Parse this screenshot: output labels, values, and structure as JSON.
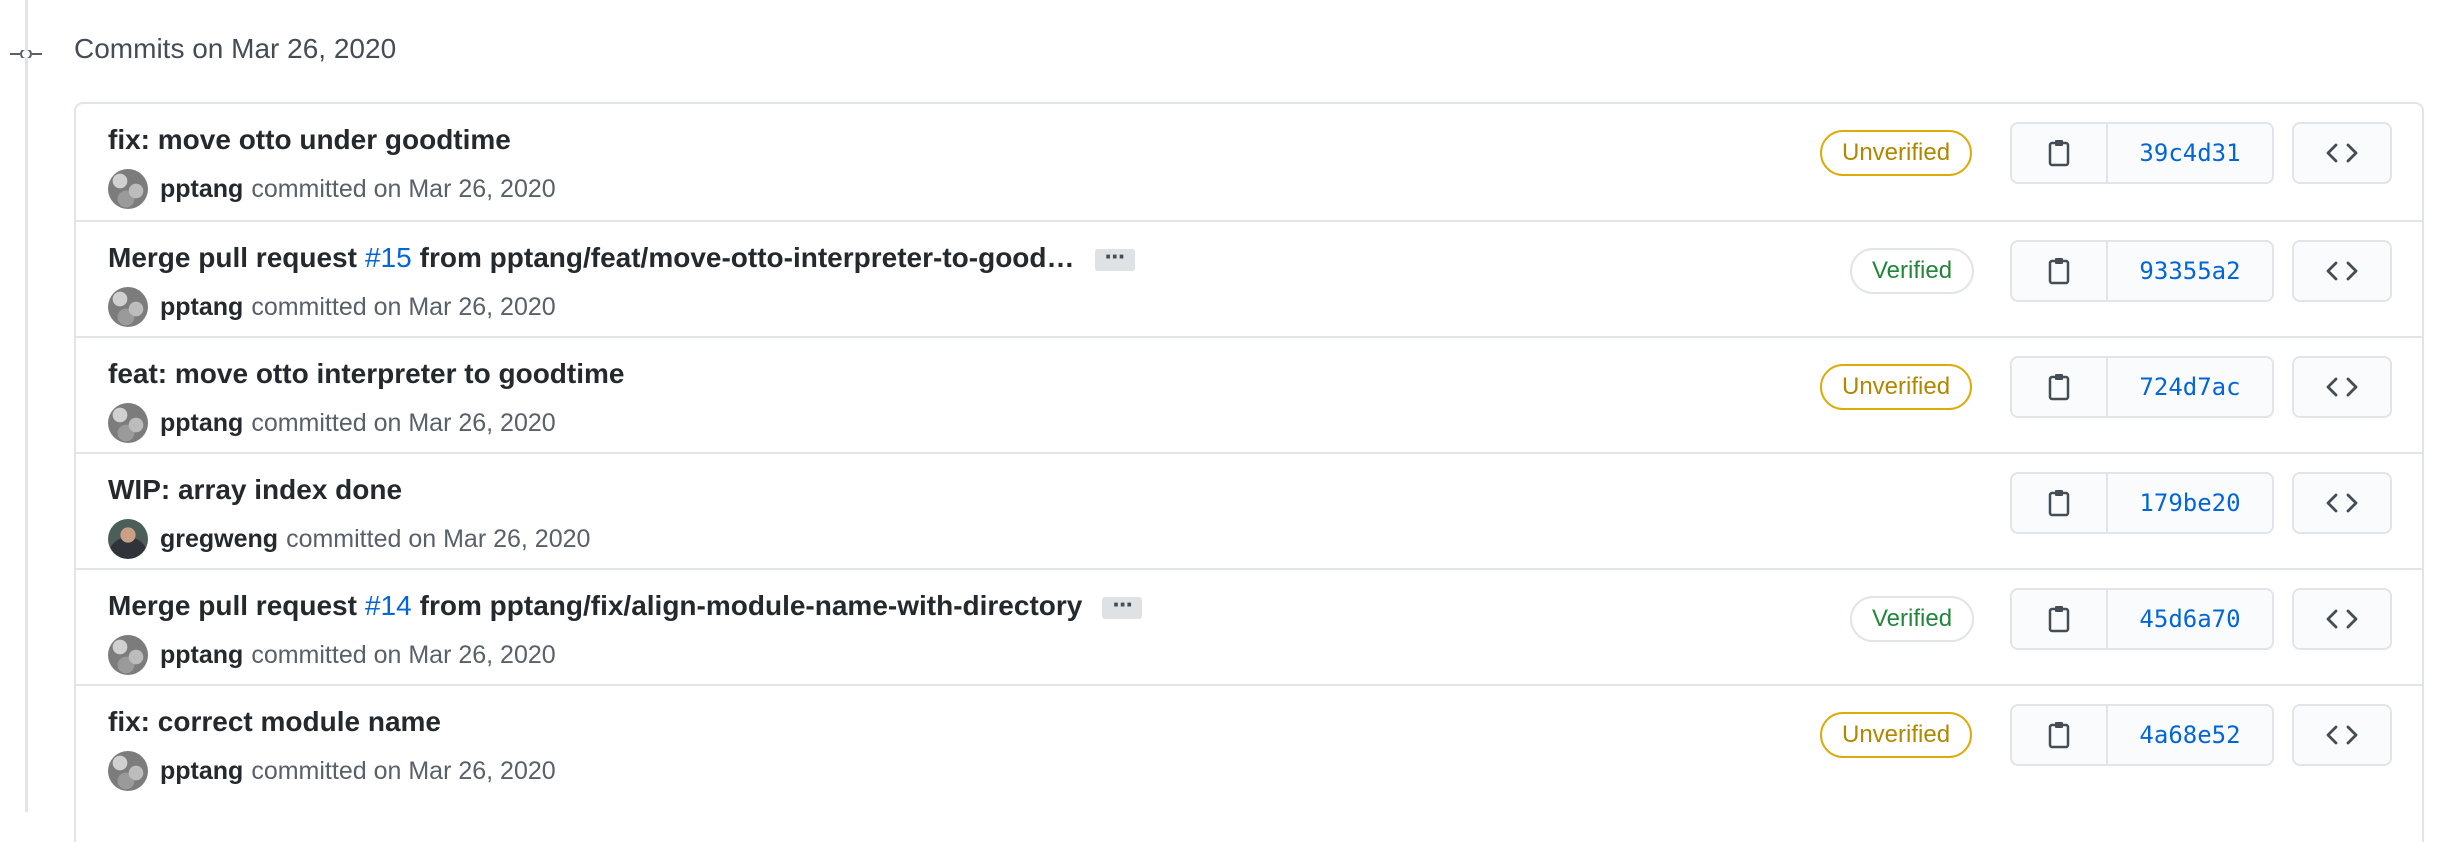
{
  "group": {
    "title": "Commits on Mar 26, 2020"
  },
  "commits": [
    {
      "title": "fix: move otto under goodtime",
      "pr_prefix": "",
      "pr_number": "",
      "pr_suffix": "",
      "author": "pptang",
      "meta": "committed on Mar 26, 2020",
      "badge": "Unverified",
      "sha": "39c4d31"
    },
    {
      "title": "",
      "pr_prefix": "Merge pull request",
      "pr_number": "#15",
      "pr_suffix": "from pptang/feat/move-otto-interpreter-to-good…",
      "author": "pptang",
      "meta": "committed on Mar 26, 2020",
      "badge": "Verified",
      "sha": "93355a2"
    },
    {
      "title": "feat: move otto interpreter to goodtime",
      "pr_prefix": "",
      "pr_number": "",
      "pr_suffix": "",
      "author": "pptang",
      "meta": "committed on Mar 26, 2020",
      "badge": "Unverified",
      "sha": "724d7ac"
    },
    {
      "title": "WIP: array index done",
      "pr_prefix": "",
      "pr_number": "",
      "pr_suffix": "",
      "author": "gregweng",
      "meta": "committed on Mar 26, 2020",
      "badge": "",
      "sha": "179be20"
    },
    {
      "title": "",
      "pr_prefix": "Merge pull request",
      "pr_number": "#14",
      "pr_suffix": "from pptang/fix/align-module-name-with-directory",
      "author": "pptang",
      "meta": "committed on Mar 26, 2020",
      "badge": "Verified",
      "sha": "45d6a70"
    },
    {
      "title": "fix: correct module name",
      "pr_prefix": "",
      "pr_number": "",
      "pr_suffix": "",
      "author": "pptang",
      "meta": "committed on Mar 26, 2020",
      "badge": "Unverified",
      "sha": "4a68e52"
    }
  ],
  "icons": {
    "commit": "git-commit-icon",
    "clipboard": "clipboard-icon",
    "browse": "code-icon",
    "ellipsis": "ellipsis-icon"
  },
  "colors": {
    "link": "#0366d6",
    "unverified": "#b08800",
    "unverified_border": "#dbab09",
    "verified": "#22863a",
    "border": "#e1e4e8"
  }
}
